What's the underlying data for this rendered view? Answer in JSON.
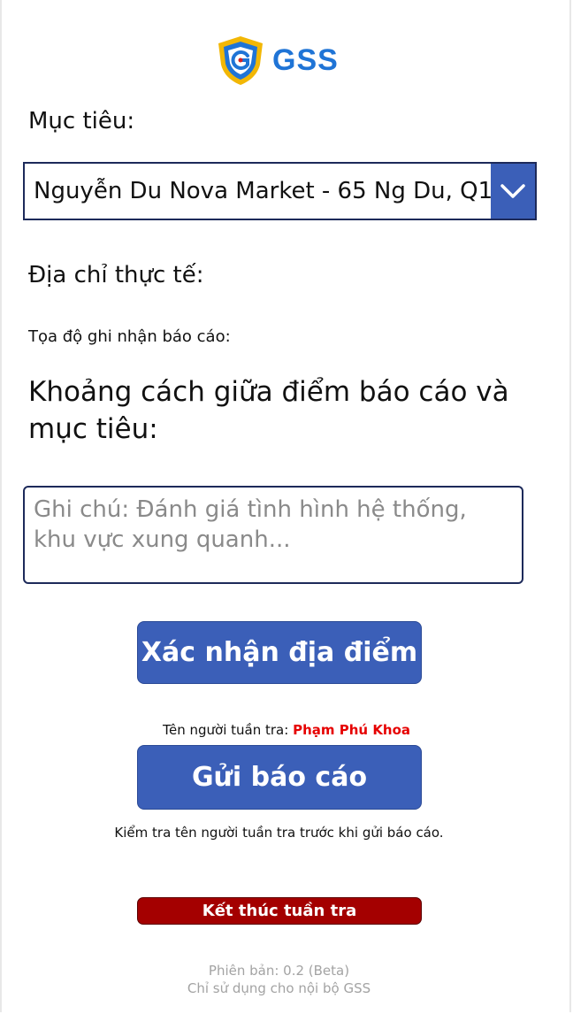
{
  "brand": {
    "name": "GSS",
    "logo_icon": "shield-g-icon",
    "colors": {
      "blue": "#1f74d6",
      "gold": "#f2b705"
    }
  },
  "form": {
    "target_label": "Mục tiêu:",
    "target_selected": "Nguyễn Du Nova Market - 65 Ng Du, Q1",
    "dropdown_icon": "chevron-down-icon",
    "actual_address_label": "Địa chỉ thực tế:",
    "report_coords_label": "Tọa độ ghi nhận báo cáo:",
    "distance_label": "Khoảng cách giữa điểm báo cáo và mục tiêu:",
    "notes_placeholder": "Ghi chú: Đánh giá tình hình hệ thống, khu vực xung quanh..."
  },
  "actions": {
    "confirm_location": "Xác nhận địa điểm",
    "patroller_label": "Tên người tuần tra:",
    "patroller_name": "Phạm Phú Khoa",
    "send_report": "Gửi báo cáo",
    "send_hint": "Kiểm tra tên người tuần tra trước khi gửi báo cáo.",
    "end_patrol": "Kết thúc tuần tra"
  },
  "footer": {
    "version": "Phiên bản: 0.2 (Beta)",
    "internal_note": "Chỉ sử dụng cho nội bộ GSS"
  },
  "colors": {
    "primary_button": "#3b5fb8",
    "danger_button": "#a40000",
    "patroller_name": "#e60000",
    "border": "#1d2a5a"
  }
}
